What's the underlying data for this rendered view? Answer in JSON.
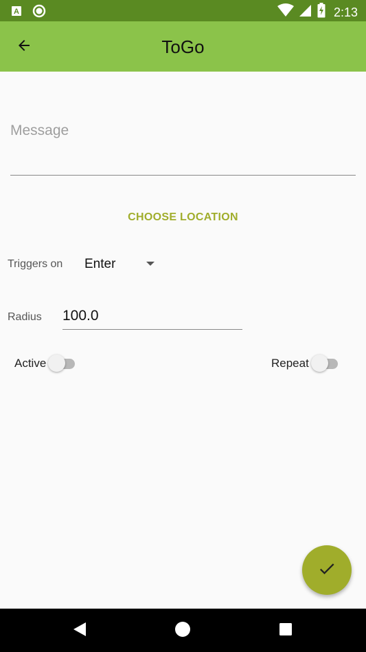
{
  "status_bar": {
    "time": "2:13",
    "left_icons": [
      "app-notification-icon",
      "sync-circle-icon"
    ],
    "right_icons": [
      "wifi-icon",
      "cellular-signal-icon",
      "battery-charging-icon"
    ]
  },
  "app_bar": {
    "title": "ToGo",
    "back_icon": "arrow-back-icon"
  },
  "form": {
    "message": {
      "value": "",
      "placeholder": "Message"
    },
    "choose_location_label": "CHOOSE LOCATION",
    "triggers": {
      "label": "Triggers on",
      "selected": "Enter"
    },
    "radius": {
      "label": "Radius",
      "value": "100.0"
    },
    "active": {
      "label": "Active",
      "on": false
    },
    "repeat": {
      "label": "Repeat",
      "on": false
    }
  },
  "fab": {
    "icon": "check-icon"
  },
  "nav_bar": {
    "icons": [
      "back-triangle-icon",
      "home-circle-icon",
      "recents-square-icon"
    ]
  },
  "colors": {
    "status_bar": "#5a8a22",
    "app_bar": "#8bc34a",
    "accent": "#a0ad2b",
    "background": "#fafafa"
  }
}
